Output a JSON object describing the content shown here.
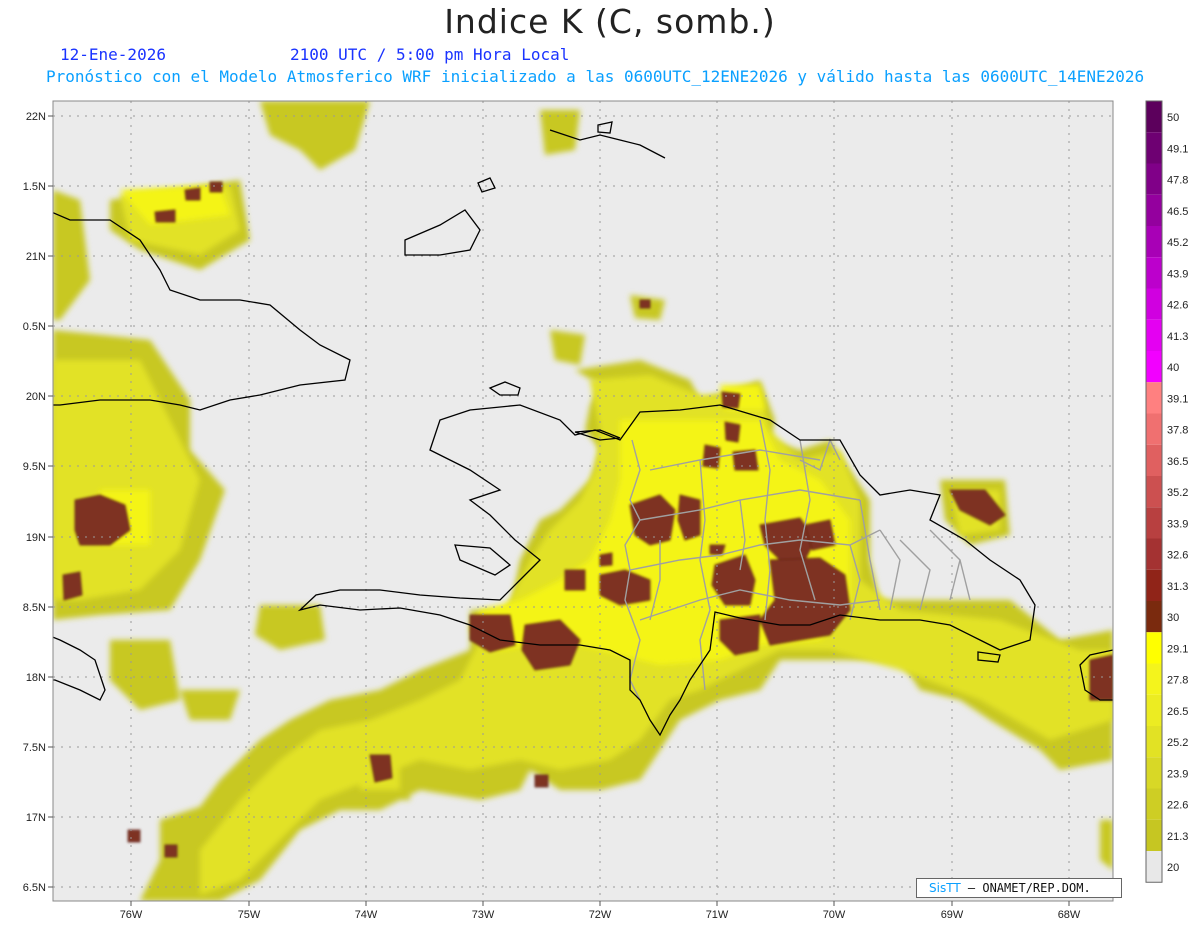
{
  "title": "Indice K (C, somb.)",
  "subtitle": {
    "date": "12-Ene-2026",
    "time": "2100 UTC / 5:00 pm Hora Local",
    "info": "Pronóstico con el Modelo Atmosferico WRF inicializado a las 0600UTC_12ENE2026 y válido hasta las  0600UTC_14ENE2026"
  },
  "map": {
    "longitudes": [
      -76,
      -75,
      -74,
      -73,
      -72,
      -71,
      -70,
      -69,
      -68
    ],
    "lon_labels": [
      "76W",
      "75W",
      "74W",
      "73W",
      "72W",
      "71W",
      "70W",
      "69W",
      "68W"
    ],
    "latitudes": [
      22,
      21.5,
      21,
      20.5,
      20,
      19.5,
      19,
      18.5,
      18,
      17.5,
      17,
      16.5
    ],
    "lat_labels": [
      "22N",
      "1.5N",
      "21N",
      "0.5N",
      "20N",
      "9.5N",
      "19N",
      "8.5N",
      "18N",
      "7.5N",
      "17N",
      "6.5N"
    ],
    "background_color": "#ebebeb",
    "coastline_color": "#000000",
    "province_border_color": "#a0a0a0"
  },
  "colorbar": {
    "labels": [
      "50",
      "49.1",
      "47.8",
      "46.5",
      "45.2",
      "43.9",
      "42.6",
      "41.3",
      "40",
      "39.1",
      "37.8",
      "36.5",
      "35.2",
      "33.9",
      "32.6",
      "31.3",
      "30",
      "29.1",
      "27.8",
      "26.5",
      "25.2",
      "23.9",
      "22.6",
      "21.3",
      "20"
    ],
    "colors": [
      "#5c005c",
      "#6e0072",
      "#800088",
      "#94009e",
      "#a800b6",
      "#bc00cc",
      "#d000e0",
      "#e400f2",
      "#f200ff",
      "#ff8080",
      "#f07070",
      "#e06060",
      "#cc5050",
      "#b84040",
      "#a43232",
      "#902418",
      "#7a2a0e",
      "#ffff00",
      "#f4f41c",
      "#ecec22",
      "#e2e224",
      "#d8d826",
      "#cece24",
      "#c6c622",
      "#e8e8e8"
    ]
  },
  "credit": {
    "brand": "SisTT",
    "org": "– ONAMET/REP.DOM."
  }
}
